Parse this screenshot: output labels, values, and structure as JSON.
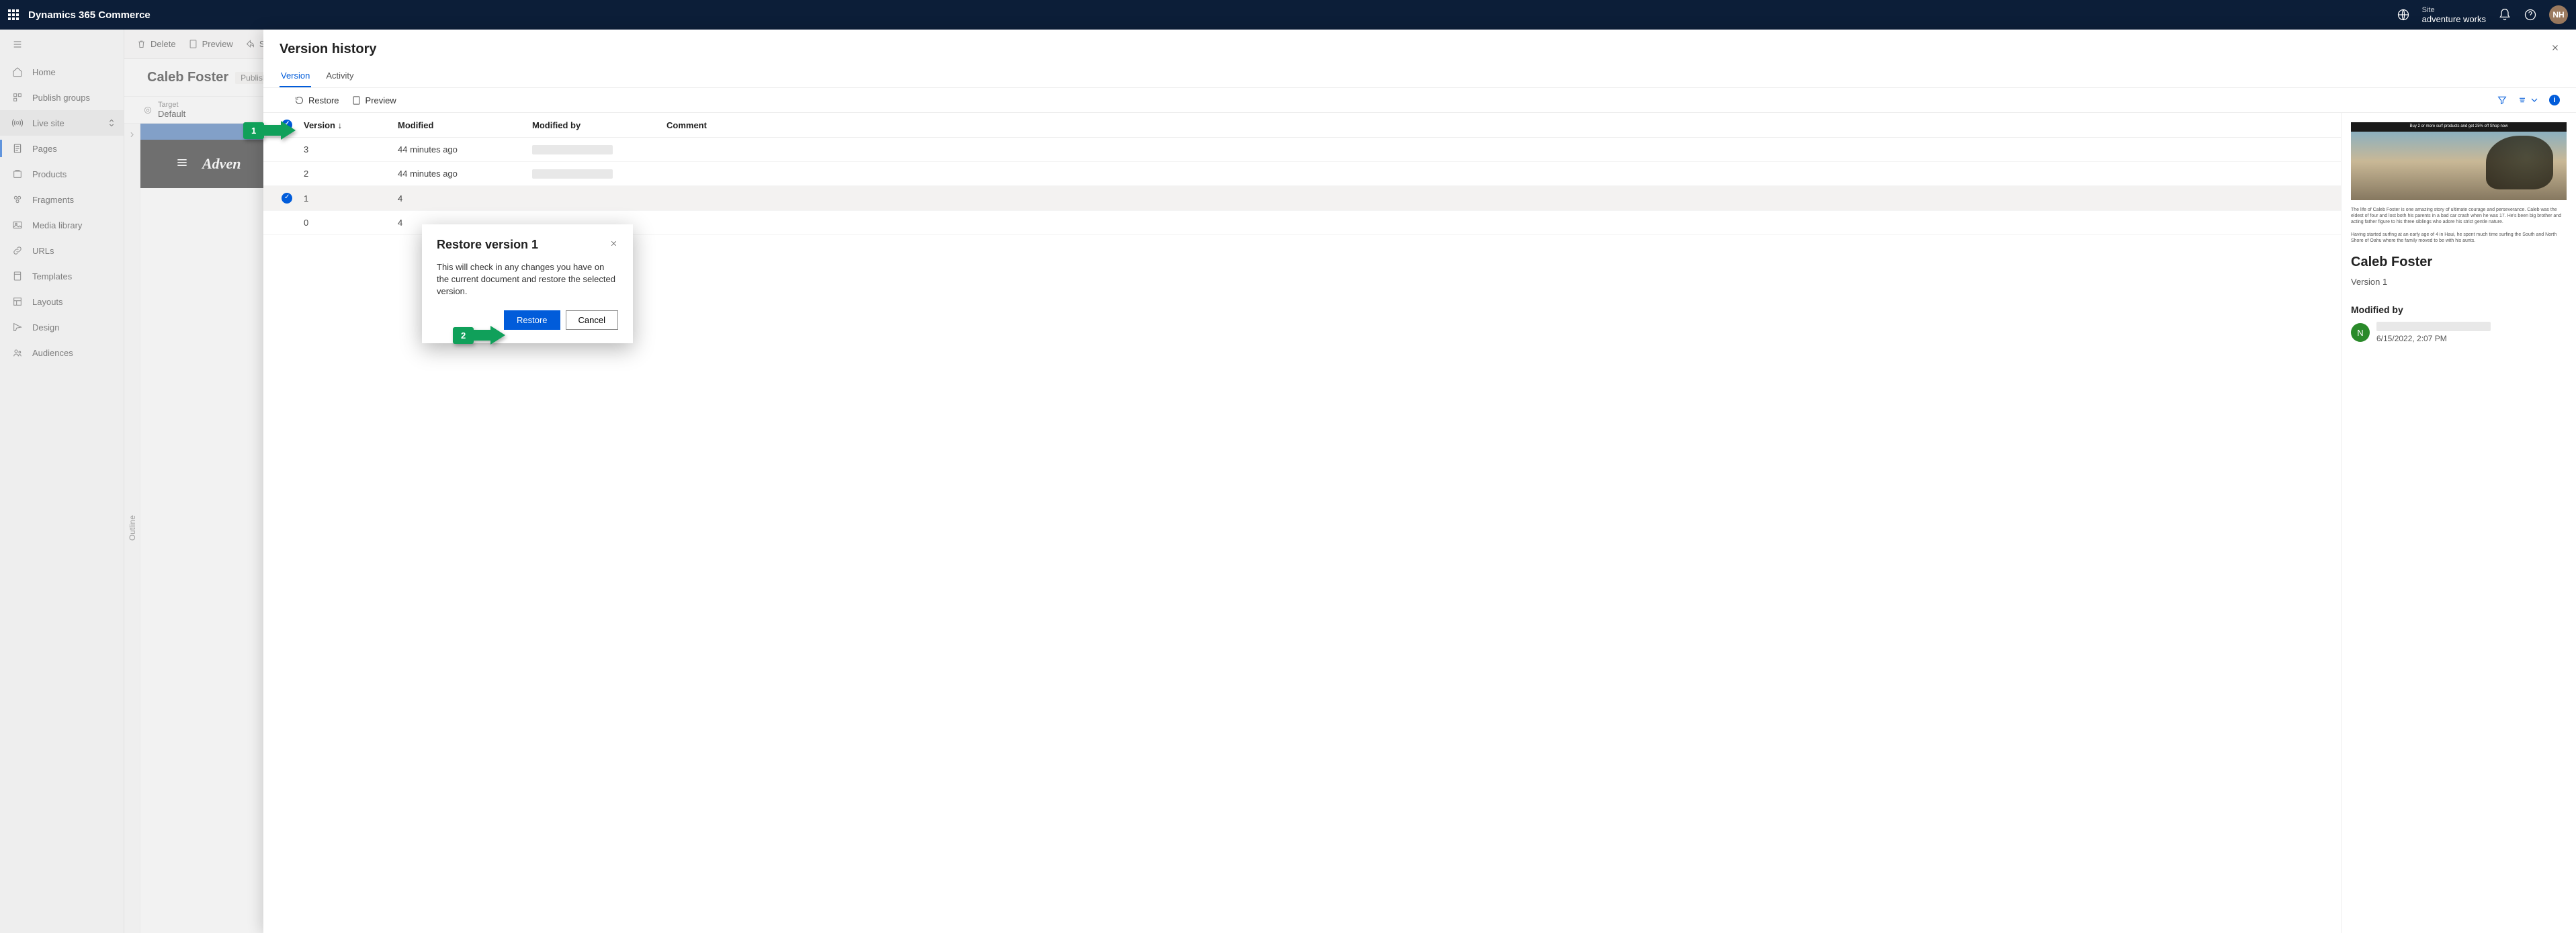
{
  "app_name": "Dynamics 365 Commerce",
  "site": {
    "label": "Site",
    "value": "adventure works"
  },
  "avatar_initials": "NH",
  "nav": {
    "items": [
      {
        "label": "Home"
      },
      {
        "label": "Publish groups"
      },
      {
        "label": "Live site"
      },
      {
        "label": "Pages"
      },
      {
        "label": "Products"
      },
      {
        "label": "Fragments"
      },
      {
        "label": "Media library"
      },
      {
        "label": "URLs"
      },
      {
        "label": "Templates"
      },
      {
        "label": "Layouts"
      },
      {
        "label": "Design"
      },
      {
        "label": "Audiences"
      }
    ]
  },
  "subbar": {
    "delete": "Delete",
    "preview": "Preview",
    "share": "S"
  },
  "page": {
    "title": "Caleb Foster",
    "status": "Published,",
    "outline": "Outline",
    "target_label": "Target",
    "target_value": "Default",
    "hero_brand": "Adven"
  },
  "panel": {
    "title": "Version history",
    "tabs": {
      "version": "Version",
      "activity": "Activity"
    },
    "toolbar": {
      "restore": "Restore",
      "preview": "Preview"
    },
    "columns": {
      "version": "Version",
      "modified": "Modified",
      "modified_by": "Modified by",
      "comment": "Comment"
    },
    "sort_indicator": "↓",
    "rows": [
      {
        "version": "3",
        "modified": "44 minutes ago"
      },
      {
        "version": "2",
        "modified": "44 minutes ago"
      },
      {
        "version": "1",
        "modified": "4"
      },
      {
        "version": "0",
        "modified": "4"
      }
    ]
  },
  "detail": {
    "thumb_banner": "Buy 2 or more surf products and get 25% off  Shop now",
    "caption1": "The life of Caleb Foster is one amazing story of ultimate courage and perseverance. Caleb was the eldest of four and lost both his parents in a bad car crash when he was 17. He's been big brother and acting father figure to his three siblings who adore his strict gentle nature.",
    "caption2": "Having started surfing at an early age of 4 in Haui, he spent much time surfing the South and North Shore of Oahu where the family moved to be with his aunts.",
    "title": "Caleb Foster",
    "subtitle": "Version 1",
    "modified_by_label": "Modified by",
    "user_initial": "N",
    "date": "6/15/2022, 2:07 PM"
  },
  "dialog": {
    "title": "Restore version 1",
    "body": "This will check in any changes you have on the current document and restore the selected version.",
    "primary": "Restore",
    "secondary": "Cancel"
  },
  "callouts": {
    "one": "1",
    "two": "2"
  }
}
